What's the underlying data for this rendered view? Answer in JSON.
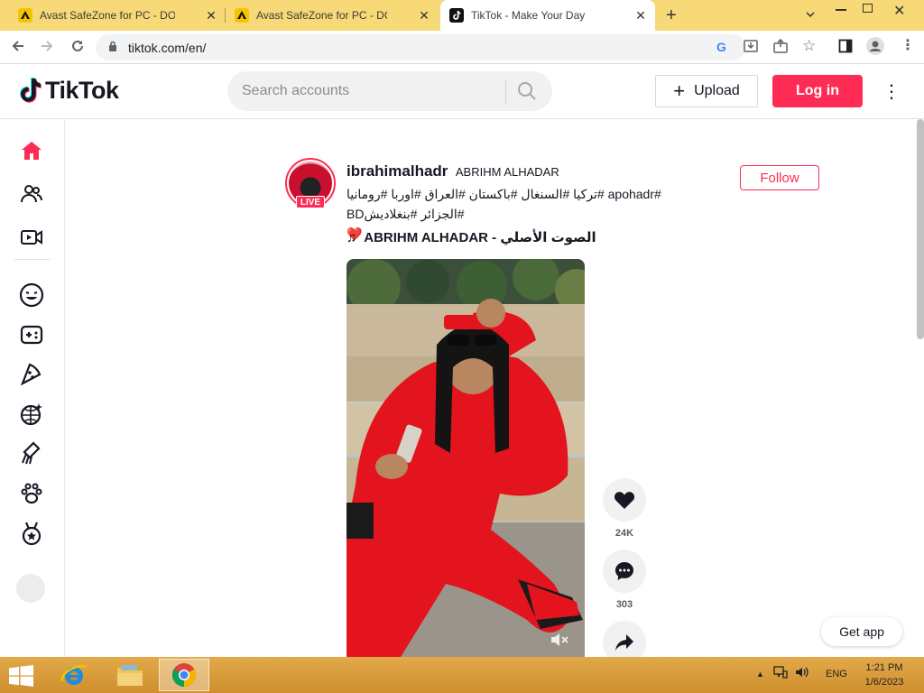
{
  "browser": {
    "tabs": [
      {
        "title": "Avast SafeZone for PC - DOWNL",
        "active": false
      },
      {
        "title": "Avast SafeZone for PC - DOWNL",
        "active": false
      },
      {
        "title": "TikTok - Make Your Day",
        "active": true
      }
    ],
    "new_tab_icon": "plus-icon",
    "url": "tiktok.com/en/"
  },
  "header": {
    "logo_text": "TikTok",
    "search_placeholder": "Search accounts",
    "upload_label": "Upload",
    "login_label": "Log in"
  },
  "sidebar": {
    "items": [
      {
        "icon": "home-icon",
        "active": true
      },
      {
        "icon": "following-icon"
      },
      {
        "icon": "live-icon"
      },
      {
        "icon": "comedy-icon"
      },
      {
        "icon": "gaming-icon"
      },
      {
        "icon": "food-icon"
      },
      {
        "icon": "dance-icon"
      },
      {
        "icon": "beauty-icon"
      },
      {
        "icon": "animals-icon"
      },
      {
        "icon": "sports-icon"
      }
    ]
  },
  "post": {
    "live_badge": "LIVE",
    "username": "ibrahimalhadr",
    "nickname": "ABRIHM ALHADAR",
    "follow_label": "Follow",
    "caption_line1": "#apohadr #تركيا #السنغال #باكستان #العراق #اوربا #رومانيا",
    "caption_line2": "#الجزائر #بنغلاديشBD❤️",
    "music": "الصوت الأصلي - ABRIHM ALHADAR",
    "like_count": "24K",
    "comment_count": "303"
  },
  "get_app_label": "Get app",
  "taskbar": {
    "language": "ENG",
    "time": "1:21 PM",
    "date": "1/6/2023"
  },
  "colors": {
    "brand": "#fe2c55",
    "tab_strip": "#f7d977",
    "taskbar": "#d99a3c"
  }
}
